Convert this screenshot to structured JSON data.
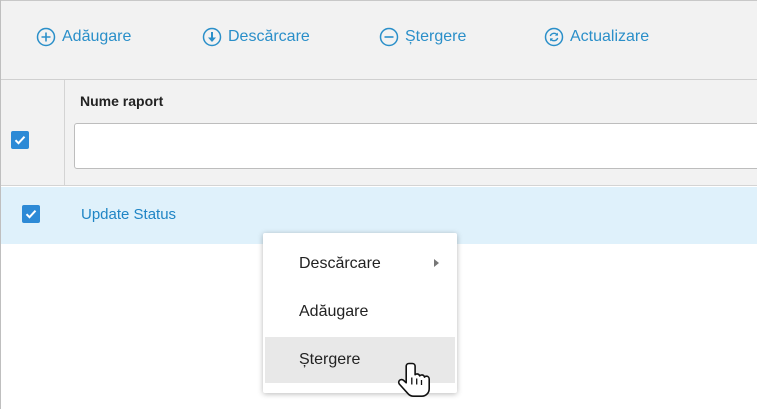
{
  "toolbar": {
    "add_label": "Adăugare",
    "download_label": "Descărcare",
    "delete_label": "Ștergere",
    "refresh_label": "Actualizare"
  },
  "grid": {
    "column_header": "Nume raport",
    "filter_value": "",
    "rows": [
      {
        "name": "Update Status",
        "checked": true
      }
    ]
  },
  "context_menu": {
    "items": [
      {
        "label": "Descărcare",
        "has_submenu": true
      },
      {
        "label": "Adăugare",
        "has_submenu": false
      },
      {
        "label": "Ștergere",
        "has_submenu": false,
        "hovered": true
      }
    ]
  },
  "colors": {
    "accent": "#2a8fc9",
    "checkbox": "#2d8ad6",
    "selected_row": "#dff1fb",
    "toolbar_bg": "#f2f2f2",
    "menu_hover": "#e8e8e8"
  },
  "icons": [
    "plus-circle-icon",
    "download-circle-icon",
    "minus-circle-icon",
    "refresh-circle-icon",
    "checkmark-icon",
    "submenu-arrow-icon",
    "hand-pointer-cursor-icon"
  ]
}
